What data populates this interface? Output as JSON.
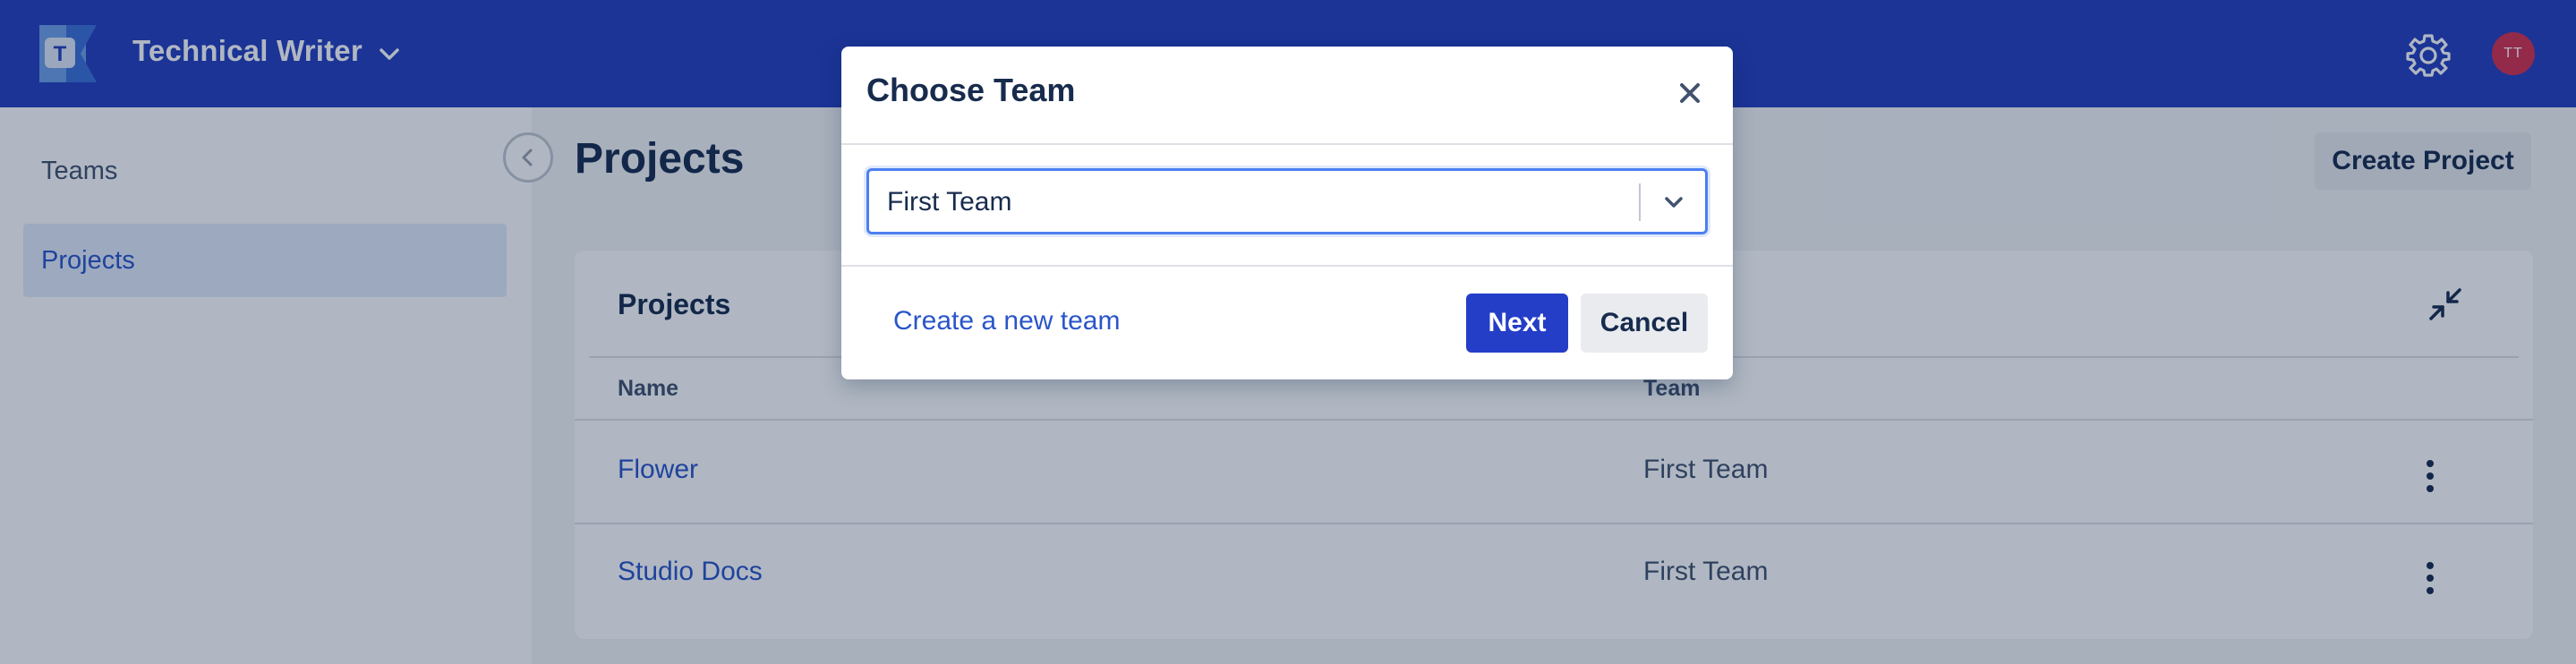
{
  "header": {
    "app_name": "Technical Writer",
    "logo_letter": "T",
    "avatar_initials": "TT",
    "icons": [
      "logo",
      "chevron-down-icon",
      "gear-icon"
    ]
  },
  "sidebar": {
    "items": [
      {
        "label": "Teams",
        "active": false
      },
      {
        "label": "Projects",
        "active": true
      }
    ]
  },
  "main": {
    "title": "Projects",
    "create_button": "Create Project",
    "card": {
      "title": "Projects",
      "columns": [
        "Name",
        "Team"
      ],
      "rows": [
        {
          "name": "Flower",
          "team": "First Team"
        },
        {
          "name": "Studio Docs",
          "team": "First Team"
        }
      ]
    }
  },
  "modal": {
    "title": "Choose Team",
    "select": {
      "value": "First Team"
    },
    "create_link": "Create a new team",
    "next_label": "Next",
    "cancel_label": "Cancel"
  },
  "colors": {
    "header_bg": "#243ebf",
    "accent": "#2a55c9",
    "primary_button": "#243ec8",
    "avatar_bg": "#d4304f"
  }
}
